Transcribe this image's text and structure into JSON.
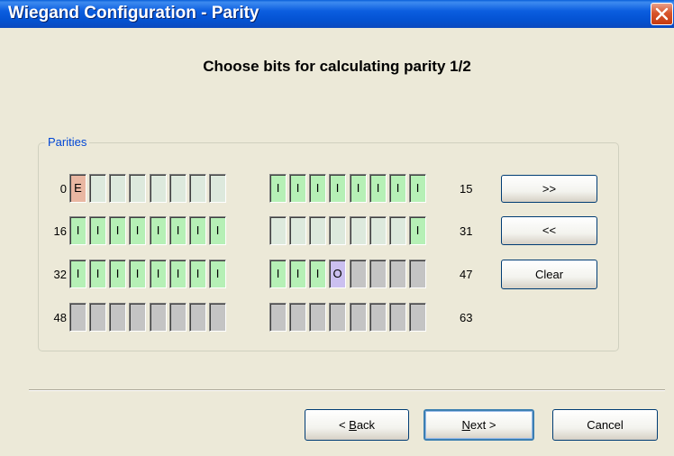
{
  "window": {
    "title": "Wiegand Configuration - Parity",
    "close_icon": "close-icon"
  },
  "heading": "Choose bits for calculating parity 1/2",
  "group": {
    "label": "Parities"
  },
  "rows": [
    {
      "start_label": "0",
      "end_label": "15",
      "cells": [
        "E",
        "",
        "",
        "",
        "",
        "",
        "",
        "",
        "I",
        "I",
        "I",
        "I",
        "I",
        "I",
        "I",
        "I"
      ]
    },
    {
      "start_label": "16",
      "end_label": "31",
      "cells": [
        "I",
        "I",
        "I",
        "I",
        "I",
        "I",
        "I",
        "I",
        "",
        "",
        "",
        "",
        "",
        "",
        "",
        "I"
      ]
    },
    {
      "start_label": "32",
      "end_label": "47",
      "cells": [
        "I",
        "I",
        "I",
        "I",
        "I",
        "I",
        "I",
        "I",
        "I",
        "I",
        "I",
        "O",
        "-",
        "-",
        "-",
        "-"
      ]
    },
    {
      "start_label": "48",
      "end_label": "63",
      "cells": [
        "-",
        "-",
        "-",
        "-",
        "-",
        "-",
        "-",
        "-",
        "-",
        "-",
        "-",
        "-",
        "-",
        "-",
        "-",
        "-"
      ]
    }
  ],
  "side_buttons": {
    "next_page": ">>",
    "prev_page": "<<",
    "clear": "Clear"
  },
  "footer": {
    "back": {
      "pre": "< ",
      "accel": "B",
      "post": "ack"
    },
    "next": {
      "pre": "",
      "accel": "N",
      "post": "ext >"
    },
    "cancel": "Cancel"
  },
  "colors": {
    "title_bar": "#0b5ddf",
    "cell_I": "#b6f0b6",
    "cell_E": "#e9b7a2",
    "cell_O": "#cbc0f0",
    "cell_empty": "#dde9dd",
    "cell_disabled": "#c4c4c4",
    "group_label": "#0046d5"
  }
}
